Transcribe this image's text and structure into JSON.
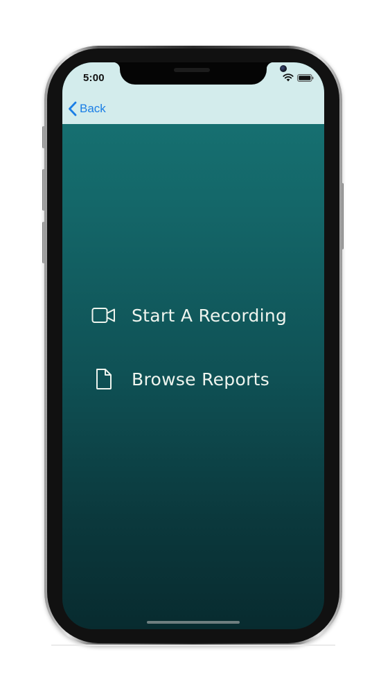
{
  "status_bar": {
    "time": "5:00",
    "wifi_icon": "wifi-icon",
    "battery_icon": "battery-icon"
  },
  "nav": {
    "back_label": "Back",
    "back_icon": "chevron-left-icon",
    "background": "#d3ecec",
    "accent": "#1a7ee6"
  },
  "menu": {
    "items": [
      {
        "label": "Start A Recording",
        "icon": "video-camera-icon"
      },
      {
        "label": "Browse Reports",
        "icon": "document-icon"
      }
    ]
  },
  "colors": {
    "gradient_top": "#177676",
    "gradient_bottom": "#082b2f",
    "menu_text": "#eef4ee"
  }
}
